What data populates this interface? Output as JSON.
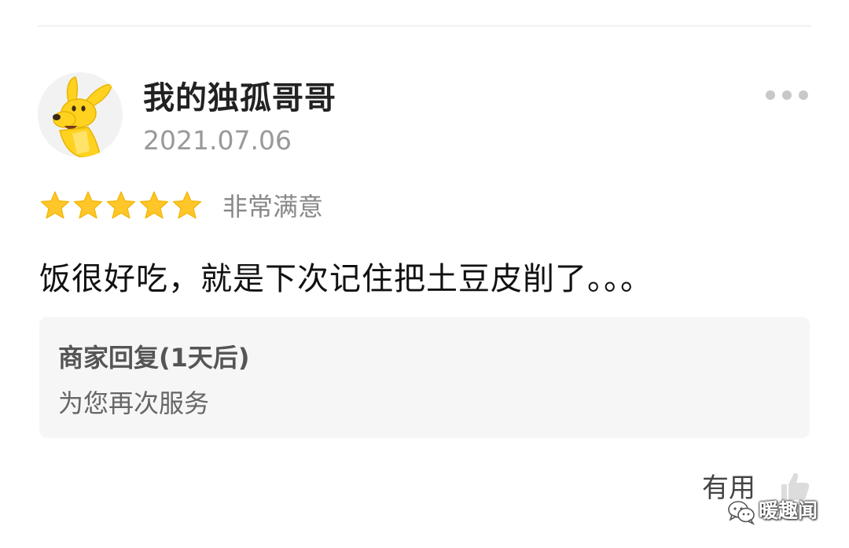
{
  "review": {
    "username": "我的独孤哥哥",
    "date": "2021.07.06",
    "rating": 5,
    "rating_max": 5,
    "rating_label": "非常满意",
    "text": "饭很好吃，就是下次记住把土豆皮削了。。。"
  },
  "merchant_reply": {
    "title": "商家回复(1天后)",
    "text": "为您再次服务"
  },
  "actions": {
    "useful_label": "有用"
  },
  "watermark": {
    "text": "暖趣闻"
  },
  "colors": {
    "star": "#FFC629",
    "avatar_mascot": "#FFD21F",
    "reply_background": "#F6F6F6",
    "muted_text": "#999999"
  },
  "icons": {
    "avatar": "yellow-dog-mascot",
    "more": "more-dots-icon",
    "star": "star-icon",
    "useful": "thumbs-up-icon",
    "watermark": "wechat-icon"
  }
}
